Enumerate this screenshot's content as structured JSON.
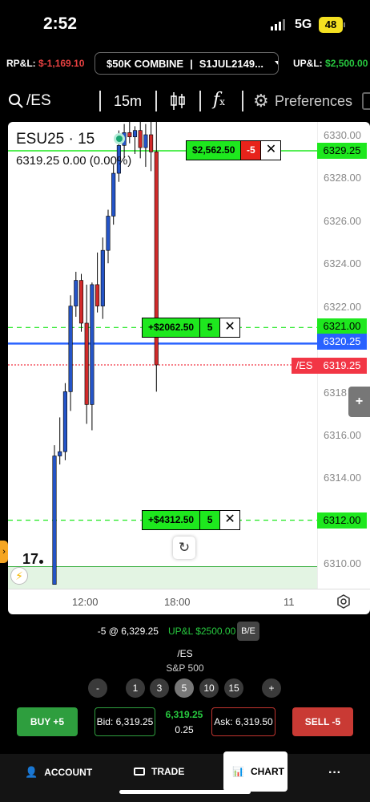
{
  "status": {
    "time": "2:52",
    "network": "5G",
    "battery": "48"
  },
  "account": {
    "rpl_label": "RP&L:",
    "rpl_value": "$-1,169.10",
    "combine": "$50K COMBINE",
    "account_id": "S1JUL2149...",
    "upl_label": "UP&L:",
    "upl_value": "$2,500.00"
  },
  "toolbar": {
    "symbol": "/ES",
    "timeframe": "15m",
    "preferences": "Preferences",
    "icons": [
      "search-icon",
      "candlestick-icon",
      "function-icon",
      "gear-icon"
    ]
  },
  "chart": {
    "title": "ESU25 · 15",
    "price": "6319.25",
    "change": "0.00 (0.00%)",
    "y_axis": [
      "6330.00",
      "6328.00",
      "6326.00",
      "6324.00",
      "6322.00",
      "6318",
      "6316.00",
      "6314.00",
      "6310.00"
    ],
    "x_axis": [
      "12:00",
      "18:00",
      "11"
    ],
    "price_tags": [
      {
        "label": "6329.25",
        "color": "#1ee81e"
      },
      {
        "label": "6321.00",
        "color": "#1ee81e"
      },
      {
        "label": "6320.25",
        "color": "#2962ff"
      },
      {
        "label": "6319.25",
        "color": "#f23645"
      },
      {
        "label": "6312.00",
        "color": "#1ee81e"
      }
    ],
    "symbol_tag": "/ES",
    "orders": [
      {
        "pnl": "$2,562.50",
        "qty": "-5",
        "close": "✕"
      },
      {
        "pnl": "+$2062.50",
        "qty": "5",
        "close": "✕"
      },
      {
        "pnl": "+$4312.50",
        "qty": "5",
        "close": "✕"
      }
    ],
    "plus": "+",
    "chart_data": {
      "type": "candlestick",
      "ylim": [
        6309,
        6331
      ],
      "candles": [
        {
          "o": 6309.0,
          "h": 6315.5,
          "l": 6309.0,
          "c": 6315.0,
          "bull": true
        },
        {
          "o": 6315.0,
          "h": 6316.8,
          "l": 6314.6,
          "c": 6315.2,
          "bull": true
        },
        {
          "o": 6315.2,
          "h": 6318.4,
          "l": 6314.8,
          "c": 6318.0,
          "bull": true
        },
        {
          "o": 6318.0,
          "h": 6322.5,
          "l": 6317.1,
          "c": 6322.0,
          "bull": true
        },
        {
          "o": 6322.0,
          "h": 6323.6,
          "l": 6321.5,
          "c": 6323.2,
          "bull": true
        },
        {
          "o": 6323.2,
          "h": 6323.5,
          "l": 6320.8,
          "c": 6321.2,
          "bull": false
        },
        {
          "o": 6321.2,
          "h": 6323.0,
          "l": 6316.5,
          "c": 6317.4,
          "bull": false
        },
        {
          "o": 6317.4,
          "h": 6323.1,
          "l": 6316.2,
          "c": 6323.0,
          "bull": true
        },
        {
          "o": 6323.0,
          "h": 6324.5,
          "l": 6321.7,
          "c": 6322.0,
          "bull": false
        },
        {
          "o": 6322.0,
          "h": 6325.2,
          "l": 6321.4,
          "c": 6324.6,
          "bull": true
        },
        {
          "o": 6324.6,
          "h": 6326.5,
          "l": 6324.0,
          "c": 6326.2,
          "bull": true
        },
        {
          "o": 6326.2,
          "h": 6328.6,
          "l": 6325.8,
          "c": 6328.2,
          "bull": true
        },
        {
          "o": 6328.2,
          "h": 6330.2,
          "l": 6327.8,
          "c": 6329.5,
          "bull": true
        },
        {
          "o": 6329.5,
          "h": 6330.5,
          "l": 6328.9,
          "c": 6330.1,
          "bull": true
        },
        {
          "o": 6330.1,
          "h": 6330.6,
          "l": 6329.6,
          "c": 6329.9,
          "bull": false
        },
        {
          "o": 6329.9,
          "h": 6330.4,
          "l": 6329.1,
          "c": 6330.2,
          "bull": true
        },
        {
          "o": 6330.2,
          "h": 6330.6,
          "l": 6328.9,
          "c": 6329.4,
          "bull": false
        },
        {
          "o": 6329.4,
          "h": 6330.5,
          "l": 6328.5,
          "c": 6330.0,
          "bull": true
        },
        {
          "o": 6330.0,
          "h": 6330.6,
          "l": 6328.3,
          "c": 6329.2,
          "bull": false
        },
        {
          "o": 6329.2,
          "h": 6330.8,
          "l": 6318.0,
          "c": 6319.25,
          "bull": false
        }
      ],
      "lines": [
        {
          "y": 6329.25,
          "color": "#1ee81e",
          "style": "solid"
        },
        {
          "y": 6321.0,
          "color": "#1ee81e",
          "style": "dashed"
        },
        {
          "y": 6320.25,
          "color": "#2962ff",
          "style": "solid"
        },
        {
          "y": 6319.25,
          "color": "#f23645",
          "style": "dotted"
        },
        {
          "y": 6312.0,
          "color": "#1ee81e",
          "style": "dashed"
        }
      ]
    }
  },
  "bottom": {
    "position": "-5 @ 6,329.25",
    "upl": "UP&L $2500.00",
    "be": "B/E",
    "symbol": "/ES",
    "description": "S&P 500",
    "quantities": [
      "-",
      "1",
      "3",
      "5",
      "10",
      "15",
      "+"
    ],
    "buy": "BUY +5",
    "bid": "Bid: 6,319.25",
    "last": "6,319.25",
    "spread": "0.25",
    "ask": "Ask: 6,319.50",
    "sell": "SELL -5"
  },
  "nav": {
    "account": "ACCOUNT",
    "trade": "TRADE",
    "chart": "CHART",
    "more": "···"
  }
}
